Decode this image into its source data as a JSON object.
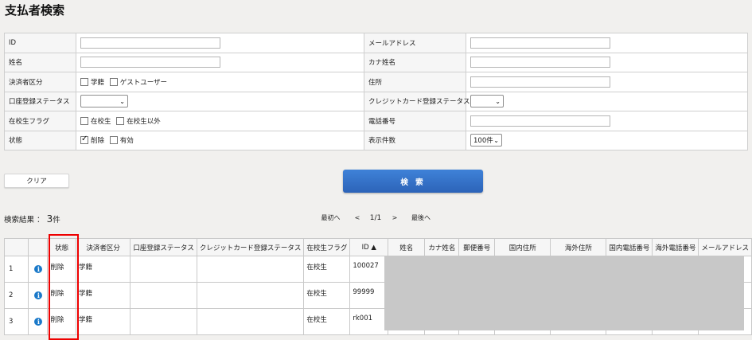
{
  "title": "支払者検索",
  "form": {
    "id_label": "ID",
    "email_label": "メールアドレス",
    "name_label": "姓名",
    "kana_label": "カナ姓名",
    "payer_type_label": "決済者区分",
    "payer_type_options": [
      "学籍",
      "ゲストユーザー"
    ],
    "address_label": "住所",
    "account_status_label": "口座登録ステータス",
    "account_status_value": "",
    "cc_status_label": "クレジットカード登録ステータス",
    "cc_status_value": "",
    "enrollment_label": "在校生フラグ",
    "enrollment_options": [
      "在校生",
      "在校生以外"
    ],
    "phone_label": "電話番号",
    "state_label": "状態",
    "state_options": [
      "削除",
      "有効"
    ],
    "state_checked": [
      true,
      false
    ],
    "count_label": "表示件数",
    "count_value": "100件"
  },
  "buttons": {
    "clear": "クリア",
    "search": "検 索"
  },
  "results": {
    "label": "検索結果 ：",
    "count": "3",
    "unit": "件",
    "pager": {
      "first": "最初へ",
      "prev": "<",
      "page": "1/1",
      "next": ">",
      "last": "最後へ"
    },
    "columns": [
      "",
      "",
      "状態",
      "決済者区分",
      "口座登録ステータス",
      "クレジットカード登録ステータス",
      "在校生フラグ",
      "ID ▲",
      "姓名",
      "カナ姓名",
      "郵便番号",
      "国内住所",
      "海外住所",
      "国内電話番号",
      "海外電話番号",
      "メールアドレス"
    ],
    "rows": [
      {
        "no": "1",
        "state": "削除",
        "payer_type": "学籍",
        "enrollment": "在校生",
        "id": "100027"
      },
      {
        "no": "2",
        "state": "削除",
        "payer_type": "学籍",
        "enrollment": "在校生",
        "id": "99999"
      },
      {
        "no": "3",
        "state": "削除",
        "payer_type": "学籍",
        "enrollment": "在校生",
        "id": "rk001"
      }
    ]
  },
  "icons": {
    "info": "info-icon",
    "check": "checkmark-icon",
    "dropdown": "chevron-down-icon"
  },
  "colors": {
    "search_button": "#2f6fca",
    "info_icon": "#1a79c9",
    "highlight_box": "#ee0000",
    "redaction": "#c8c8c8"
  }
}
